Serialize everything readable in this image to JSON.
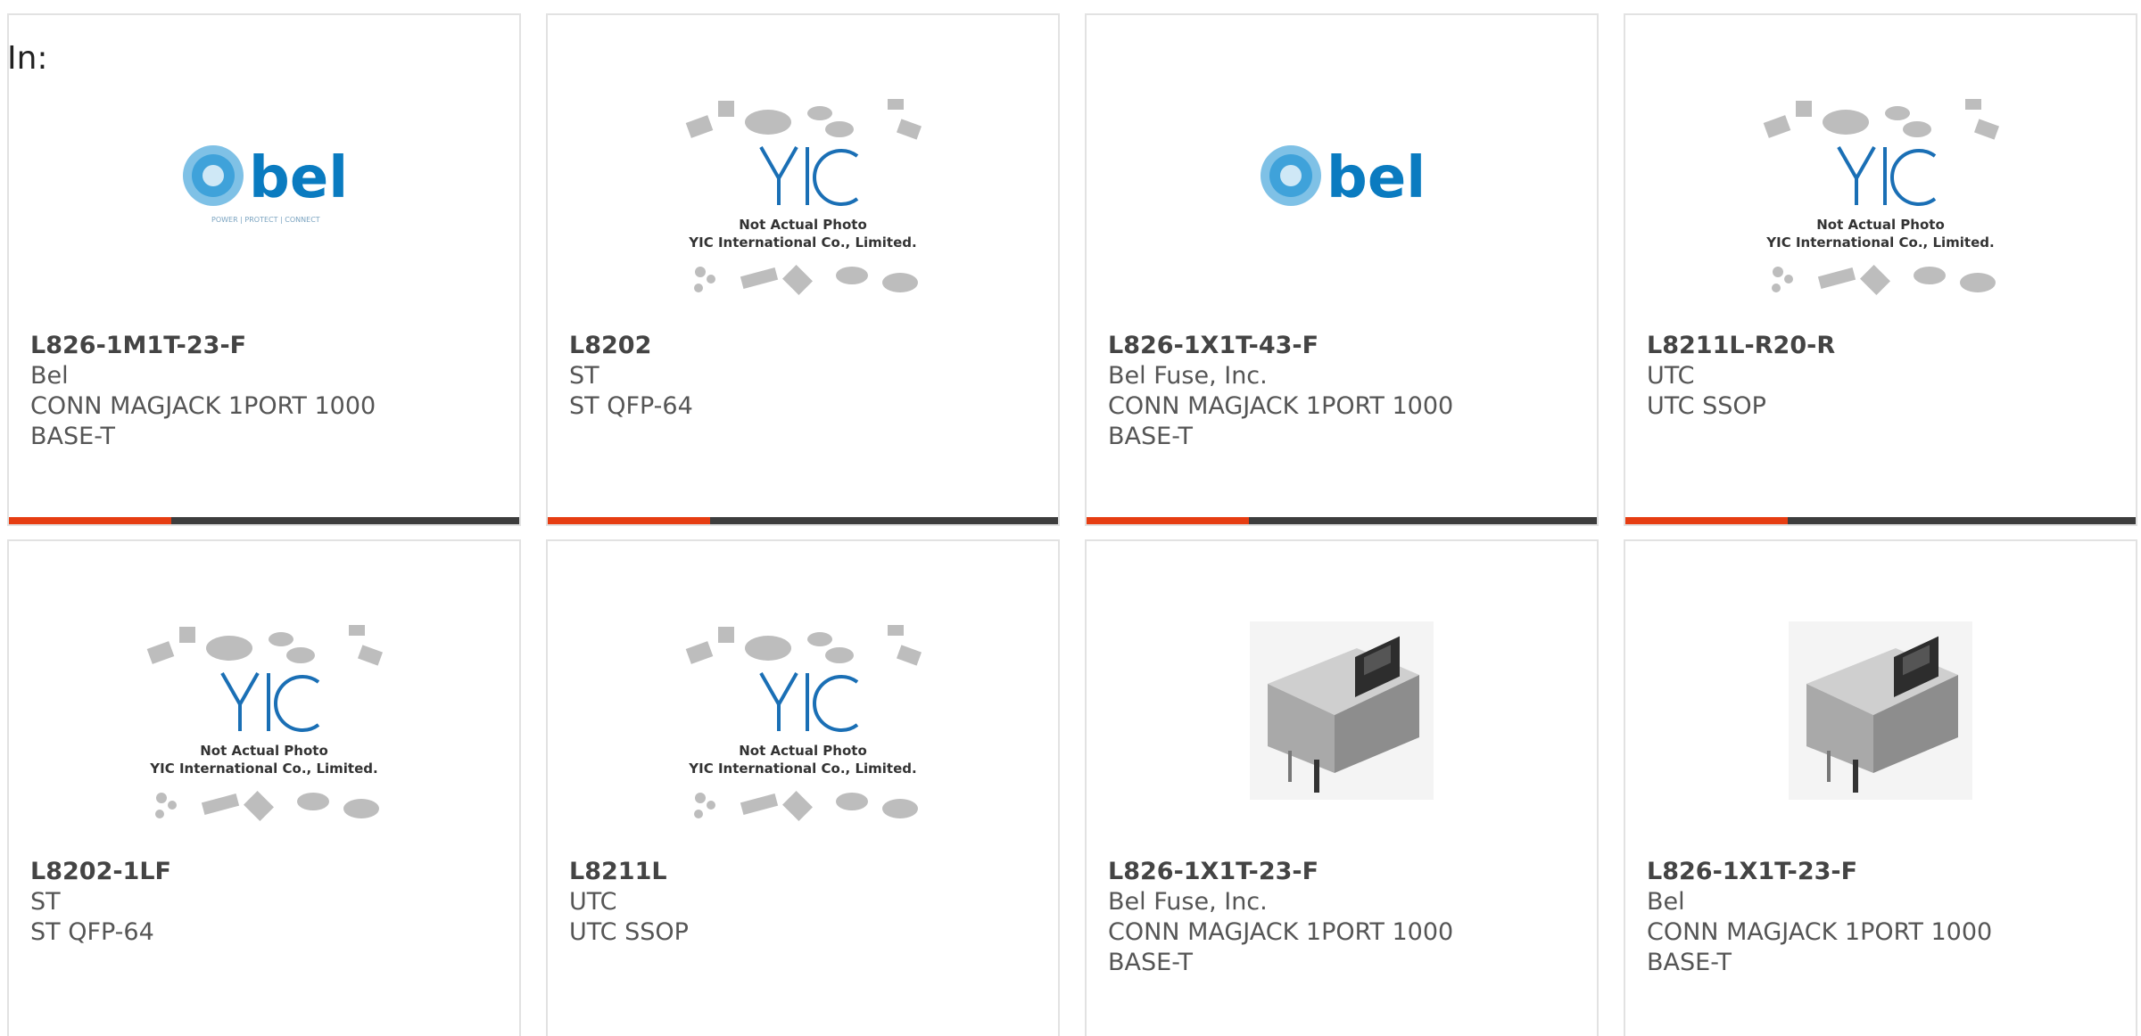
{
  "filter_label": "In:",
  "cards": [
    {
      "part_number": "L826-1M1T-23-F",
      "manufacturer": "Bel",
      "description": "CONN MAGJACK 1PORT 1000 BASE-T",
      "image": "bel-logo",
      "image_tagline": "POWER | PROTECT | CONNECT"
    },
    {
      "part_number": "L8202",
      "manufacturer": "ST",
      "description": "ST QFP-64",
      "image": "yic-placeholder",
      "image_text_1": "Not Actual Photo",
      "image_text_2": "YIC International Co., Limited."
    },
    {
      "part_number": "L826-1X1T-43-F",
      "manufacturer": "Bel Fuse, Inc.",
      "description": "CONN MAGJACK 1PORT 1000 BASE-T",
      "image": "bel-logo"
    },
    {
      "part_number": "L8211L-R20-R",
      "manufacturer": "UTC",
      "description": "UTC SSOP",
      "image": "yic-placeholder",
      "image_text_1": "Not Actual Photo",
      "image_text_2": "YIC International Co., Limited."
    },
    {
      "part_number": "L8202-1LF",
      "manufacturer": "ST",
      "description": "ST QFP-64",
      "image": "yic-placeholder",
      "image_text_1": "Not Actual Photo",
      "image_text_2": "YIC International Co., Limited."
    },
    {
      "part_number": "L8211L",
      "manufacturer": "UTC",
      "description": "UTC SSOP",
      "image": "yic-placeholder",
      "image_text_1": "Not Actual Photo",
      "image_text_2": "YIC International Co., Limited."
    },
    {
      "part_number": "L826-1X1T-23-F",
      "manufacturer": "Bel Fuse, Inc.",
      "description": "CONN MAGJACK 1PORT 1000 BASE-T",
      "image": "rj45-jack-photo"
    },
    {
      "part_number": "L826-1X1T-23-F",
      "manufacturer": "Bel",
      "description": "CONN MAGJACK 1PORT 1000 BASE-T",
      "image": "rj45-jack-photo"
    }
  ],
  "colors": {
    "accent": "#e63d12",
    "bar": "#3d3d3d",
    "bel_blue": "#0a7bc0",
    "yic_blue": "#1a6fb5"
  }
}
